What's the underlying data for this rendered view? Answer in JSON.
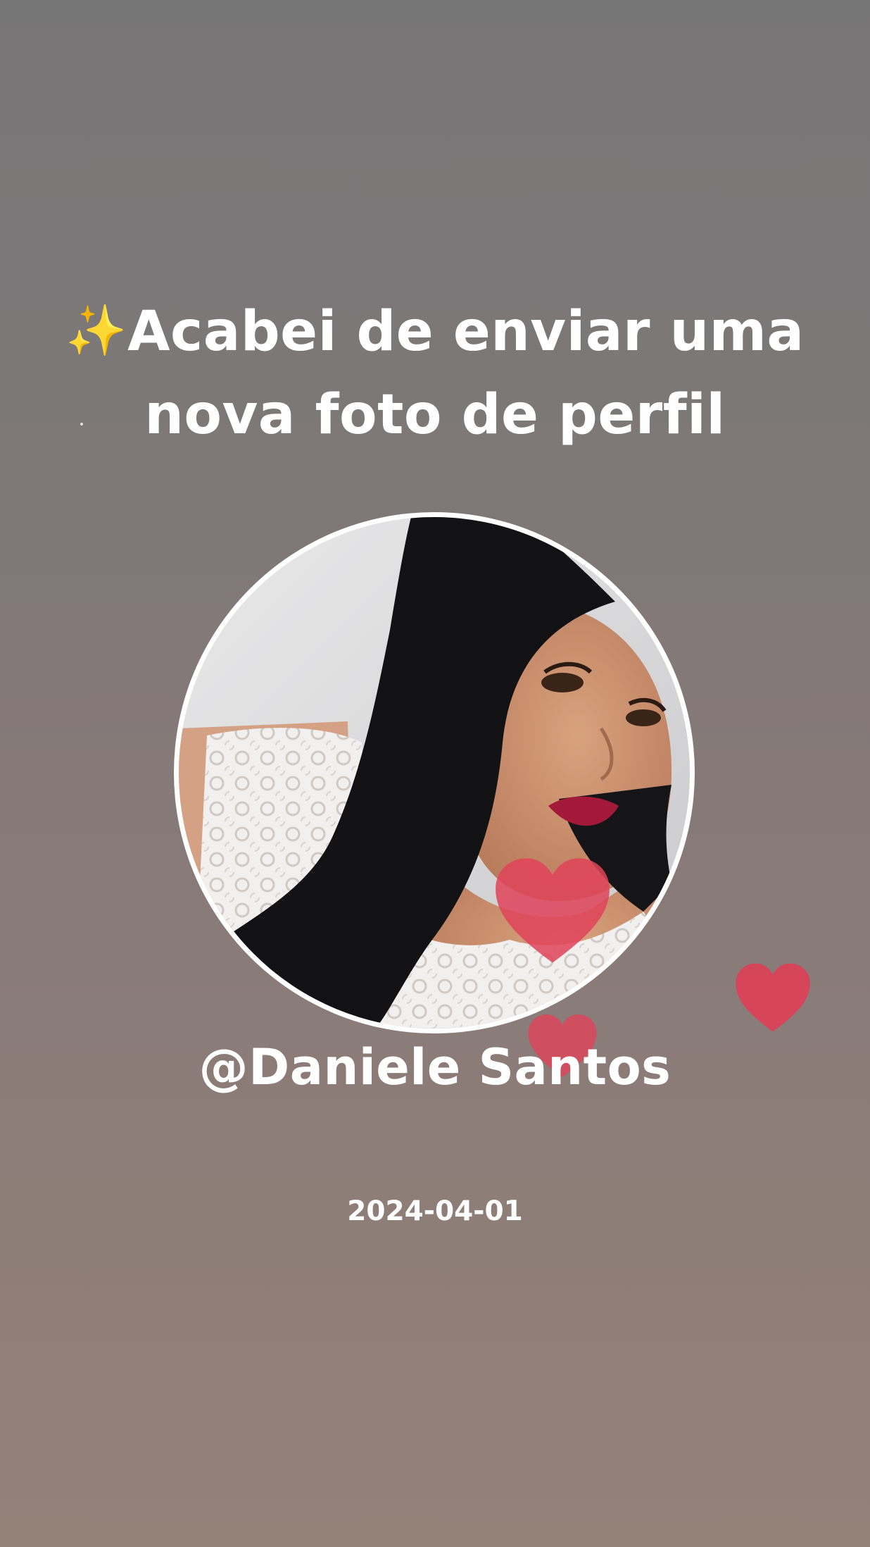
{
  "post": {
    "title_icon": "✨",
    "title": "Acabei de enviar uma nova foto de perfil",
    "username": "@Daniele Santos",
    "date": "2024-04-01"
  },
  "icons": {
    "title": "sparkles-icon",
    "decor": "heart-icon"
  },
  "colors": {
    "heart": "#e0435a",
    "text": "#ffffff",
    "avatar_ring": "#ffffff"
  }
}
